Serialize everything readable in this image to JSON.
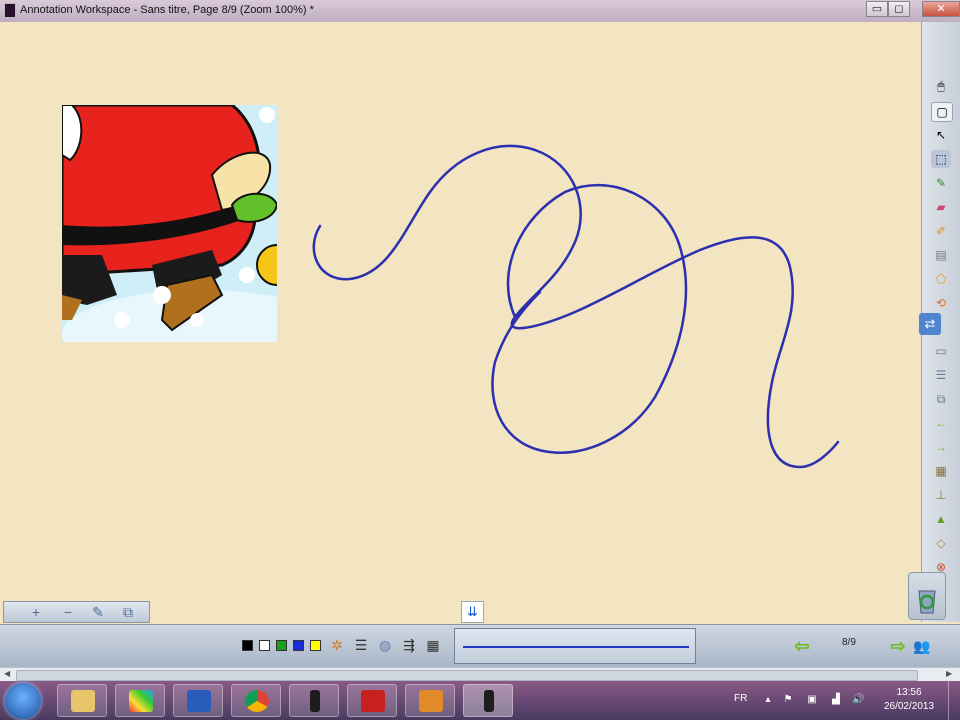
{
  "window": {
    "title": "Annotation Workspace - Sans titre, Page 8/9  (Zoom 100%) *",
    "controls": {
      "minimize": "▭",
      "maximize": "◻",
      "close": "✕"
    }
  },
  "canvas": {
    "background": "#f3e4c2",
    "ink_color": "#2b2fb0",
    "inserted_image": "santa-clipart"
  },
  "right_toolbar": {
    "icons": [
      "mouse-icon",
      "copy-page-icon",
      "pointer-icon",
      "select-icon",
      "pen-icon",
      "eraser-icon",
      "highlighter-icon",
      "ruler-icon",
      "shape-icon",
      "undo-shape-icon",
      "page-icon",
      "page-list-icon",
      "page-copy-icon",
      "back-arrow-icon",
      "forward-arrow-icon",
      "grid-icon",
      "stamp-icon",
      "image-insert-icon",
      "tag-icon",
      "close-circle-icon",
      "recycle-icon"
    ]
  },
  "zoom_tools": {
    "zoom_in": "+",
    "zoom_out": "−",
    "edit": "✎",
    "fit": "⧉"
  },
  "collapse_button": {
    "label": "⇊"
  },
  "bottom_toolbar": {
    "colors": [
      "#000000",
      "#ffffff",
      "#1aa01a",
      "#1a2cd6",
      "#ffff00"
    ],
    "selected_line_color": "#2436c9",
    "page_counter": "8/9"
  },
  "taskbar": {
    "language": "FR",
    "time": "13:56",
    "date": "26/02/2013",
    "apps": [
      "explorer",
      "paint",
      "word",
      "chrome",
      "annotation-1",
      "acrobat",
      "folder-app",
      "annotation-2"
    ]
  }
}
